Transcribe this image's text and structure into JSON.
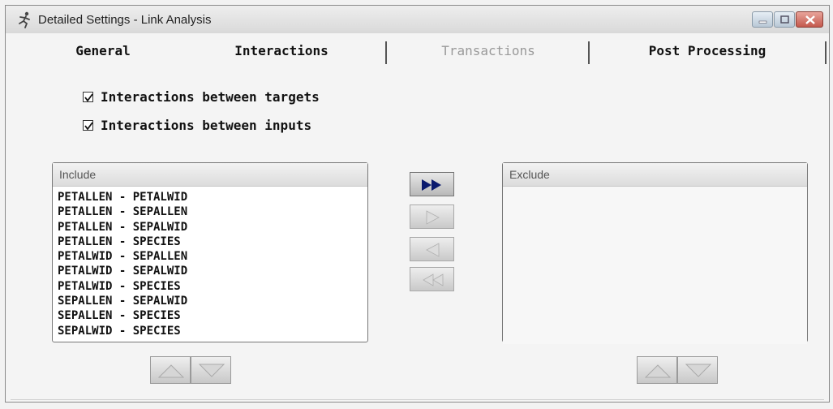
{
  "window": {
    "title": "Detailed Settings - Link Analysis",
    "icon": "running-figure-icon",
    "controls": [
      "minimize-icon",
      "maximize-icon",
      "close-icon"
    ]
  },
  "tabs": [
    {
      "label": "General",
      "enabled": true
    },
    {
      "label": "Interactions",
      "enabled": true,
      "selected": true
    },
    {
      "label": "Transactions",
      "enabled": false
    },
    {
      "label": "Post Processing",
      "enabled": true
    }
  ],
  "options": {
    "targets": {
      "label": "Interactions between targets",
      "checked": true
    },
    "inputs": {
      "label": "Interactions between inputs",
      "checked": true
    }
  },
  "include": {
    "header": "Include",
    "items": [
      "PETALLEN - PETALWID",
      "PETALLEN - SEPALLEN",
      "PETALLEN - SEPALWID",
      "PETALLEN - SPECIES",
      "PETALWID - SEPALLEN",
      "PETALWID - SEPALWID",
      "PETALWID - SPECIES",
      "SEPALLEN - SEPALWID",
      "SEPALLEN - SPECIES",
      "SEPALWID - SPECIES"
    ]
  },
  "exclude": {
    "header": "Exclude",
    "items": []
  },
  "move_buttons": {
    "move_all_right": {
      "icon": "double-arrow-right-icon",
      "enabled": true
    },
    "move_right": {
      "icon": "arrow-right-icon",
      "enabled": false
    },
    "move_left": {
      "icon": "arrow-left-icon",
      "enabled": false
    },
    "move_all_left": {
      "icon": "double-arrow-left-icon",
      "enabled": false
    }
  },
  "order_buttons": {
    "up_icon": "arrow-up-icon",
    "down_icon": "arrow-down-icon"
  },
  "colors": {
    "active_arrow": "#0a1a6e",
    "disabled_arrow": "#d8d8d8"
  }
}
